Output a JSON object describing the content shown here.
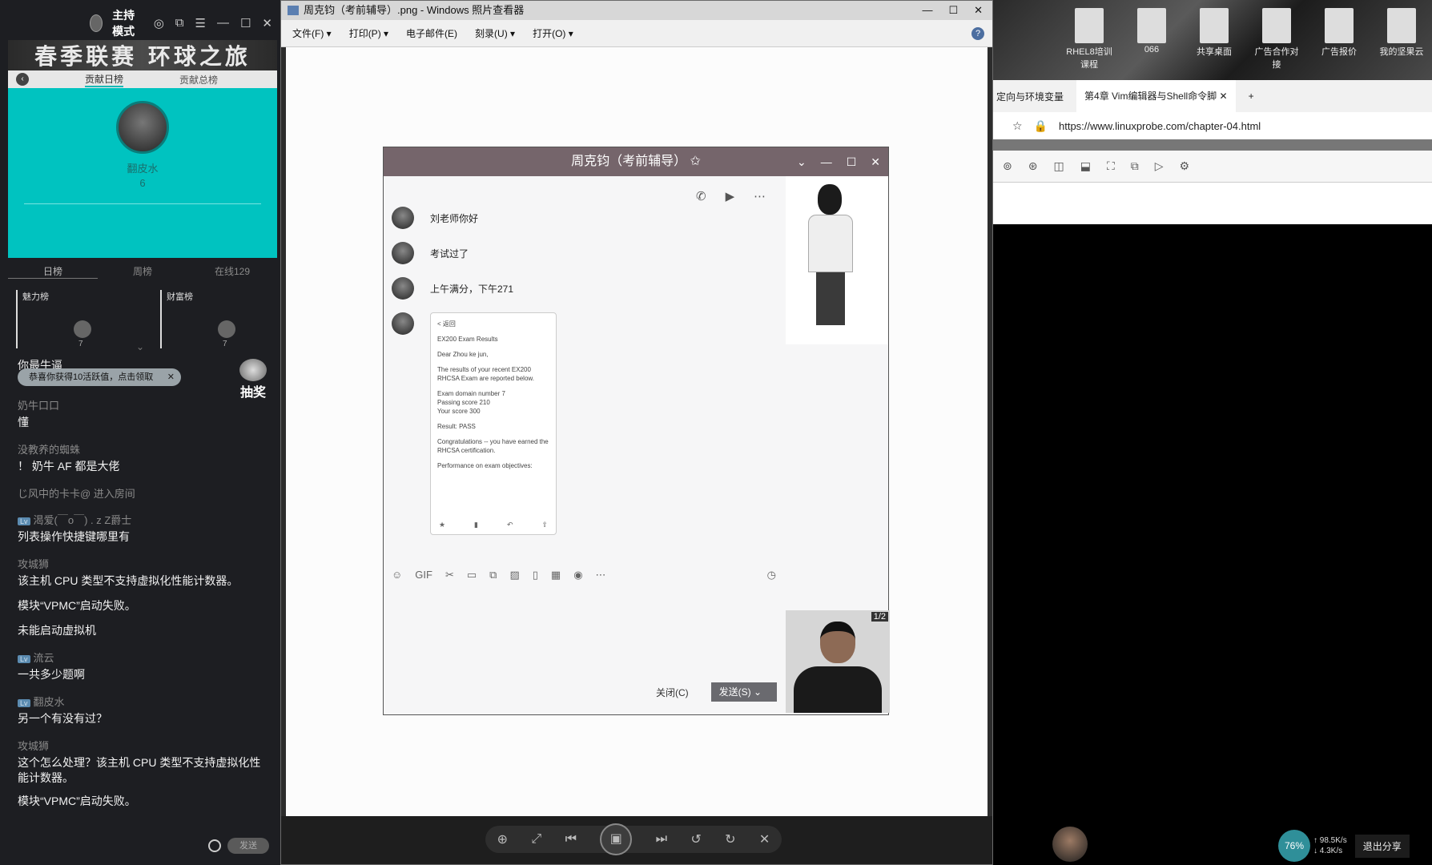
{
  "left_panel": {
    "mode_label": "主持模式",
    "banner": "春季联赛 环球之旅",
    "tab_daily": "贡献日榜",
    "tab_total": "贡献总榜",
    "top_user_name": "翻皮水",
    "top_user_score": "6",
    "rank_tabs": [
      "日榜",
      "周榜",
      "在线129"
    ],
    "board_charm": "魅力榜",
    "board_wealth": "财富榜",
    "board_charm_val": "7",
    "board_wealth_val": "7",
    "toast": "恭喜你获得10活跃值，点击领取",
    "draw_label": "抽奖",
    "send_label": "发送",
    "chat": [
      {
        "user": "",
        "text": "你最牛逼"
      },
      {
        "user": "奶牛口口",
        "text": "懂"
      },
      {
        "user": "没教养的蜘蛛",
        "text": "！ 奶牛 AF 都是大佬"
      },
      {
        "sys": "じ风中的卡卡@ 进入房间"
      },
      {
        "user": "渴爱(￣o￣) . z Z爵士",
        "text": "列表操作快捷键哪里有",
        "badge": "Lv"
      },
      {
        "user": "攻城狮",
        "text": "该主机 CPU 类型不支持虚拟化性能计数器。"
      },
      {
        "user": "",
        "text": "模块“VPMC”启动失败。"
      },
      {
        "user": "",
        "text": "未能启动虚拟机"
      },
      {
        "user": "流云",
        "text": "一共多少题啊",
        "badge": "Lv"
      },
      {
        "user": "翻皮水",
        "text": "另一个有没有过？",
        "badge": "Lv"
      },
      {
        "user": "攻城狮",
        "text": "这个怎么处理？该主机 CPU 类型不支持虚拟化性能计数器。"
      },
      {
        "user": "",
        "text": "模块“VPMC”启动失败。"
      }
    ]
  },
  "viewer": {
    "title": "周克钧（考前辅导）.png - Windows 照片查看器",
    "menu": [
      "文件(F) ▾",
      "打印(P) ▾",
      "电子邮件(E)",
      "刻录(U) ▾",
      "打开(O) ▾"
    ],
    "help": "?"
  },
  "qq": {
    "title": "周克钧（考前辅导）",
    "messages": [
      "刘老师你好",
      "考试过了",
      "上午满分，下午271"
    ],
    "shot": {
      "back": "< 返回",
      "subject": "EX200 Exam Results",
      "greet": "Dear Zhou ke jun,",
      "body1": "The results of your recent EX200 RHCSA Exam are reported below.",
      "l1": "Exam domain number    7",
      "l2": "Passing score        210",
      "l3": "Your score           300",
      "result": "Result: PASS",
      "congrats": "Congratulations -- you have earned the RHCSA certification.",
      "perf": "Performance on exam objectives:"
    },
    "close_label": "关闭(C)",
    "send_label": "发送(S)",
    "webcam_tag": "1/2"
  },
  "desktop": {
    "icons": [
      "RHEL8培训课程",
      "066",
      "共享桌面",
      "广告合作对接",
      "广告报价",
      "我的坚果云"
    ]
  },
  "browser": {
    "tab1": "定向与环境变量",
    "tab2": "第4章 Vim编辑器与Shell命令脚",
    "url": "https://www.linuxprobe.com/chapter-04.html"
  },
  "taskbar": {
    "percent": "76%",
    "up": "↑ 98.5K/s",
    "down": "↓ 4.3K/s",
    "exit_label": "退出分享"
  }
}
